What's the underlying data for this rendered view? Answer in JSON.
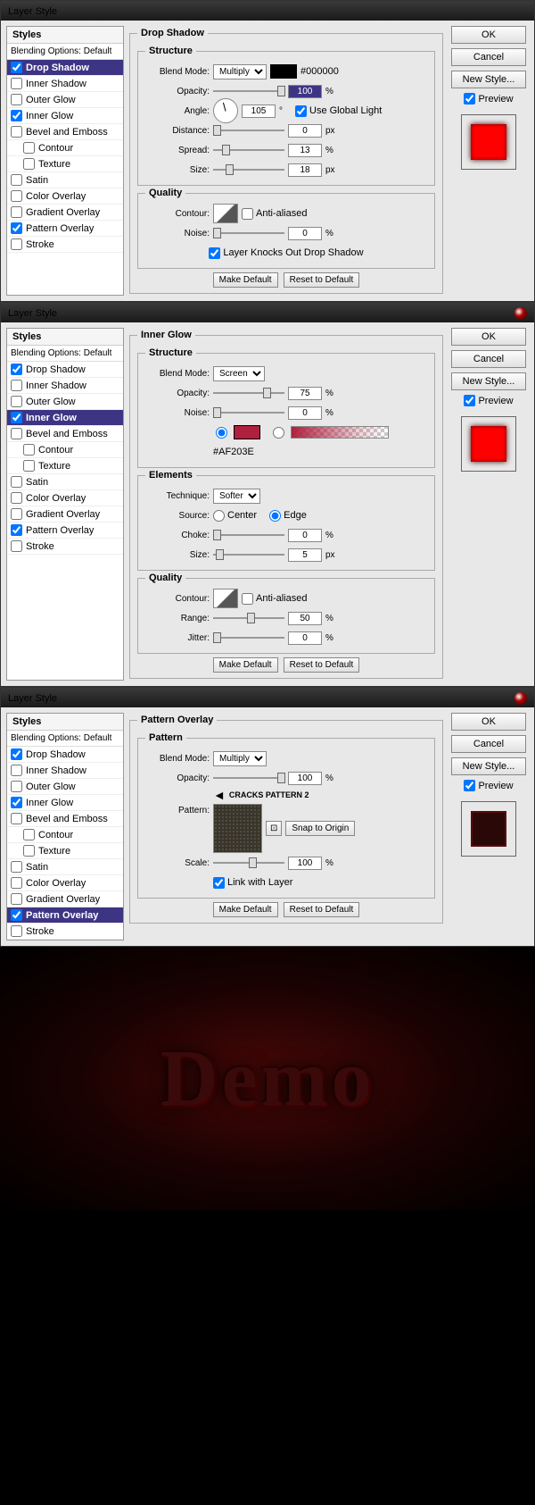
{
  "dialogs": [
    {
      "title": "Layer Style",
      "selected": "Drop Shadow",
      "panel_title": "Drop Shadow",
      "structure": {
        "blend_mode": "Multiply",
        "color": "#000000",
        "opacity": "100",
        "angle": "105",
        "use_global_light": true,
        "distance": "0",
        "spread": "13",
        "size": "18"
      },
      "quality": {
        "anti_aliased": false,
        "noise": "0",
        "knockout": true
      },
      "preview_type": "red"
    },
    {
      "title": "Layer Style",
      "selected": "Inner Glow",
      "panel_title": "Inner Glow",
      "structure": {
        "blend_mode": "Screen",
        "opacity": "75",
        "noise": "0",
        "color_hex": "#AF203E"
      },
      "elements": {
        "technique": "Softer",
        "source": "Edge",
        "choke": "0",
        "size": "5"
      },
      "quality": {
        "anti_aliased": false,
        "range": "50",
        "jitter": "0"
      },
      "preview_type": "red"
    },
    {
      "title": "Layer Style",
      "selected": "Pattern Overlay",
      "panel_title": "Pattern Overlay",
      "pattern": {
        "blend_mode": "Multiply",
        "opacity": "100",
        "note": "CRACKS PATTERN 2",
        "snap": "Snap to Origin",
        "scale": "100",
        "link": true
      },
      "preview_type": "pattern"
    }
  ],
  "styles_list": [
    {
      "label": "Drop Shadow",
      "checked": true
    },
    {
      "label": "Inner Shadow",
      "checked": false
    },
    {
      "label": "Outer Glow",
      "checked": false
    },
    {
      "label": "Inner Glow",
      "checked": true
    },
    {
      "label": "Bevel and Emboss",
      "checked": false
    },
    {
      "label": "Contour",
      "checked": false,
      "indent": true
    },
    {
      "label": "Texture",
      "checked": false,
      "indent": true
    },
    {
      "label": "Satin",
      "checked": false
    },
    {
      "label": "Color Overlay",
      "checked": false
    },
    {
      "label": "Gradient Overlay",
      "checked": false
    },
    {
      "label": "Pattern Overlay",
      "checked": true
    },
    {
      "label": "Stroke",
      "checked": false
    }
  ],
  "labels": {
    "styles": "Styles",
    "blending": "Blending Options: Default",
    "ok": "OK",
    "cancel": "Cancel",
    "new_style": "New Style...",
    "preview": "Preview",
    "structure": "Structure",
    "quality": "Quality",
    "elements": "Elements",
    "pattern": "Pattern",
    "blend_mode": "Blend Mode:",
    "opacity": "Opacity:",
    "angle": "Angle:",
    "use_global": "Use Global Light",
    "distance": "Distance:",
    "spread": "Spread:",
    "size": "Size:",
    "contour": "Contour:",
    "anti_aliased": "Anti-aliased",
    "noise": "Noise:",
    "knockout": "Layer Knocks Out Drop Shadow",
    "technique": "Technique:",
    "source": "Source:",
    "center": "Center",
    "edge": "Edge",
    "choke": "Choke:",
    "range": "Range:",
    "jitter": "Jitter:",
    "pattern_lbl": "Pattern:",
    "scale": "Scale:",
    "link_layer": "Link with Layer",
    "make_default": "Make Default",
    "reset_default": "Reset to Default",
    "px": "px",
    "pct": "%",
    "deg": "°"
  },
  "demo_text": "Demo"
}
